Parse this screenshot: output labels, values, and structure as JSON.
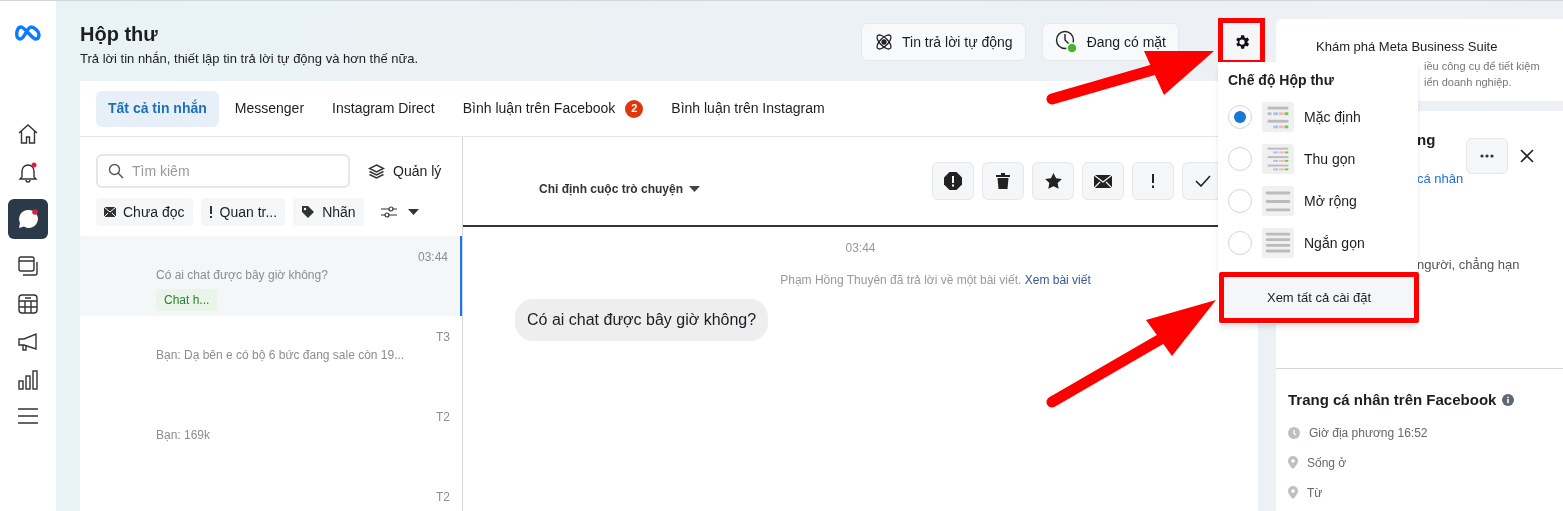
{
  "header": {
    "title": "Hộp thư",
    "subtitle": "Trả lời tin nhắn, thiết lập tin trả lời tự động và hơn thế nữa.",
    "buttons": [
      {
        "kind": "auto",
        "label": "Tin trả lời tự động"
      },
      {
        "kind": "status",
        "label": "Đang có mặt"
      },
      {
        "kind": "settings"
      }
    ]
  },
  "tabs": [
    {
      "label": "Tất cả tin nhắn",
      "selected": true
    },
    {
      "label": "Messenger",
      "selected": false
    },
    {
      "label": "Instagram Direct",
      "selected": false
    },
    {
      "label": "Bình luận trên Facebook",
      "selected": false,
      "badge": "2"
    },
    {
      "label": "Bình luận trên Instagram",
      "selected": false
    }
  ],
  "search": {
    "placeholder": "Tìm kiêm"
  },
  "manage": "Quản lý",
  "filters": [
    {
      "kind": "unread",
      "label": "Chưa đọc"
    },
    {
      "kind": "important",
      "label": "Quan tr..."
    },
    {
      "kind": "label",
      "label": "Nhãn"
    },
    {
      "kind": "more"
    }
  ],
  "conversations": [
    {
      "time": "03:44",
      "preview": "Có ai chat được bây giờ không?",
      "tag": "Chat h...",
      "selected": true
    },
    {
      "time": "T3",
      "preview": "Bạn: Dạ bên e có bộ 6 bức đang sale còn 19...",
      "selected": false
    },
    {
      "time": "T2",
      "preview": "Bạn: 169k",
      "selected": false
    },
    {
      "time": "T2",
      "selected": false
    }
  ],
  "thread": {
    "assign": "Chỉ định cuộc trò chuyện",
    "actions": [
      {
        "kind": "spam"
      },
      {
        "kind": "delete"
      },
      {
        "kind": "star"
      },
      {
        "kind": "unread"
      },
      {
        "kind": "important"
      },
      {
        "kind": "done"
      }
    ],
    "time": "03:44",
    "notice": "Phạm Hồng Thuyên đã trả lời về một bài viết.",
    "notice_link": "Xem bài viết",
    "message": "Có ai chat được bây giờ không?"
  },
  "dropdown": {
    "title": "Chế độ Hộp thư",
    "options": [
      {
        "label": "Mặc định",
        "selected": true,
        "kind": "default"
      },
      {
        "label": "Thu gọn",
        "selected": false,
        "kind": "compact"
      },
      {
        "label": "Mở rộng",
        "selected": false,
        "kind": "expanded"
      },
      {
        "label": "Ngắn gọn",
        "selected": false,
        "kind": "brief"
      }
    ],
    "button": "Xem tất cả cài đặt"
  },
  "promo": {
    "title": "Khám phá Meta Business Suite",
    "line_1": "iều công cụ để tiết kiệm",
    "line_2": "iển doanh nghiệp."
  },
  "contact": {
    "heading_part": "ng",
    "link_part": "cá nhân",
    "text_part": "người, chẳng hạn"
  },
  "profile": {
    "title": "Trang cá nhân trên Facebook",
    "rows": [
      {
        "kind": "clock",
        "text": "Giờ địa phương 16:52"
      },
      {
        "kind": "pin",
        "text": "Sống ở"
      },
      {
        "kind": "pin",
        "text": "Từ"
      }
    ]
  }
}
